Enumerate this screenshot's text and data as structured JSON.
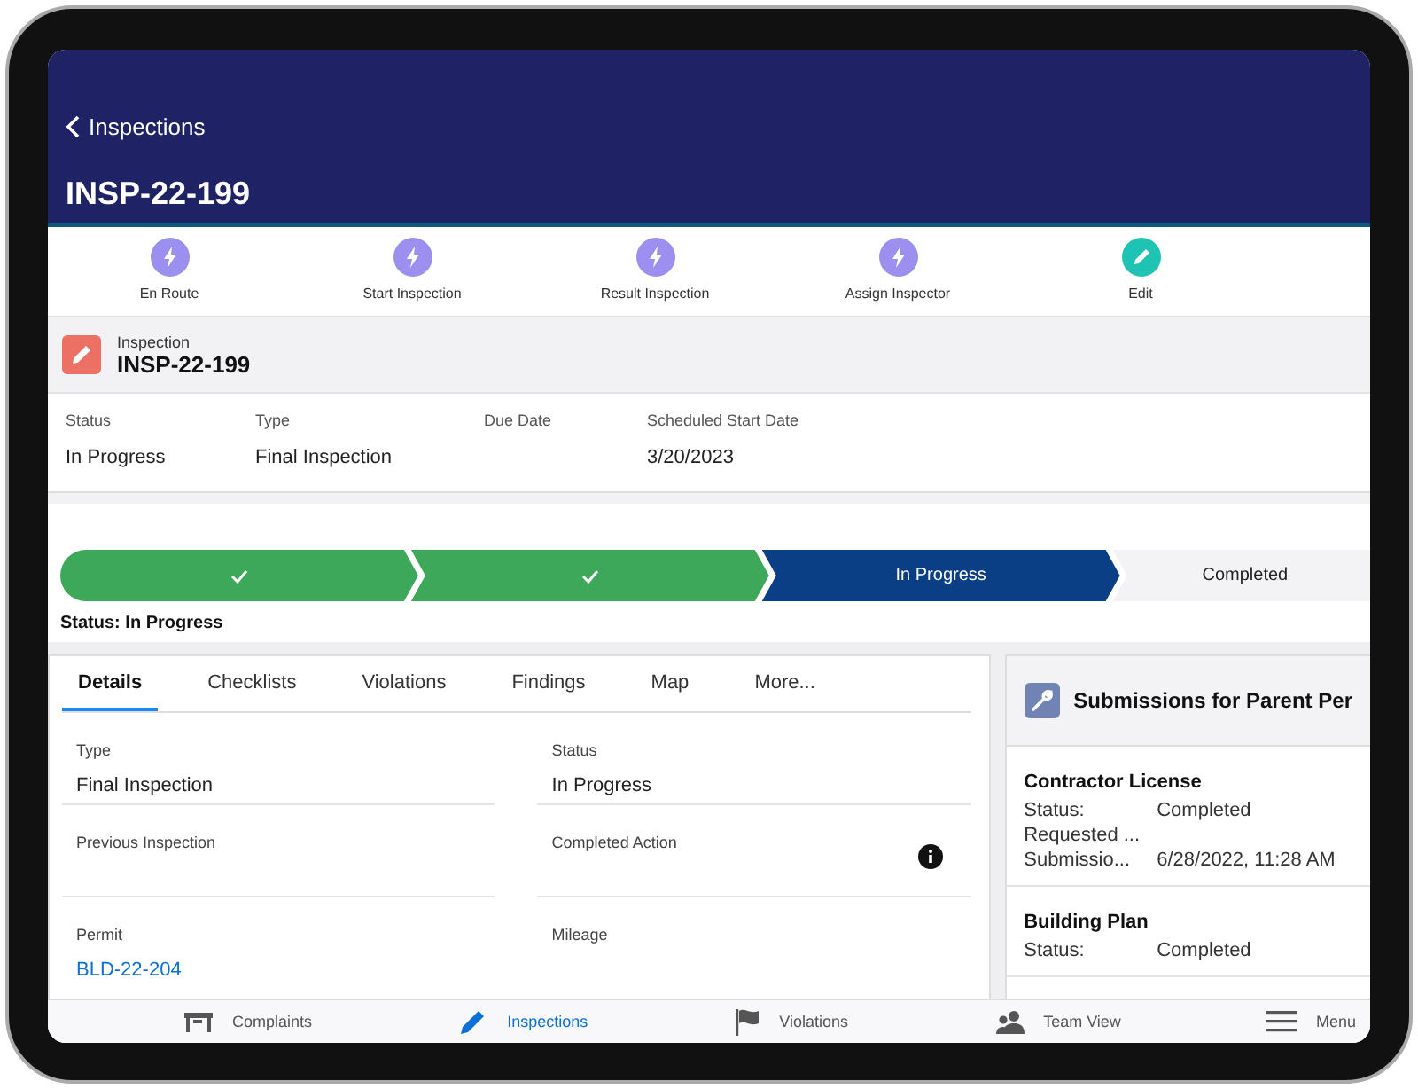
{
  "header": {
    "back_label": "Inspections",
    "title": "INSP-22-199"
  },
  "actions": [
    {
      "label": "En Route",
      "kind": "bolt"
    },
    {
      "label": "Start Inspection",
      "kind": "bolt"
    },
    {
      "label": "Result Inspection",
      "kind": "bolt"
    },
    {
      "label": "Assign Inspector",
      "kind": "bolt"
    },
    {
      "label": "Edit",
      "kind": "edit"
    }
  ],
  "record": {
    "object_label": "Inspection",
    "name": "INSP-22-199"
  },
  "highlights": [
    {
      "label": "Status",
      "value": "In Progress"
    },
    {
      "label": "Type",
      "value": "Final Inspection"
    },
    {
      "label": "Due Date"
    },
    {
      "label": "Scheduled Start Date",
      "value": "3/20/2023"
    }
  ],
  "path": {
    "steps": [
      {
        "kind": "complete"
      },
      {
        "kind": "complete"
      },
      {
        "label": "In Progress",
        "kind": "current"
      },
      {
        "label": "Completed",
        "kind": "upcoming"
      }
    ],
    "status_text": "Status: In Progress"
  },
  "tabs": [
    {
      "label": "Details",
      "selected": true
    },
    {
      "label": "Checklists",
      "selected": false
    },
    {
      "label": "Violations",
      "selected": false
    },
    {
      "label": "Findings",
      "selected": false
    },
    {
      "label": "Map",
      "selected": false
    },
    {
      "label": "More...",
      "selected": false
    }
  ],
  "details": [
    {
      "label": "Type",
      "value": "Final Inspection",
      "kind": "text"
    },
    {
      "label": "Status",
      "value": "In Progress",
      "kind": "text"
    },
    {
      "label": "Previous Inspection",
      "kind": "text"
    },
    {
      "label": "Completed Action",
      "kind": "info"
    },
    {
      "label": "Permit",
      "value": "BLD-22-204",
      "kind": "link"
    },
    {
      "label": "Mileage",
      "kind": "text"
    }
  ],
  "submissions": {
    "title": "Submissions for Parent Per",
    "items": [
      {
        "name": "Contractor License",
        "fields": [
          {
            "label": "Status:",
            "value": "Completed"
          },
          {
            "label": "Requested ..."
          },
          {
            "label": "Submissio...",
            "value": "6/28/2022, 11:28 AM"
          }
        ]
      },
      {
        "name": "Building Plan",
        "fields": [
          {
            "label": "Status:",
            "value": "Completed"
          }
        ]
      }
    ]
  },
  "bottom_nav": [
    {
      "label": "Complaints",
      "kind": "complaints",
      "selected": false
    },
    {
      "label": "Inspections",
      "kind": "inspections",
      "selected": true
    },
    {
      "label": "Violations",
      "kind": "violations",
      "selected": false
    },
    {
      "label": "Team View",
      "kind": "team",
      "selected": false
    },
    {
      "label": "Menu",
      "kind": "menu",
      "selected": false
    }
  ]
}
